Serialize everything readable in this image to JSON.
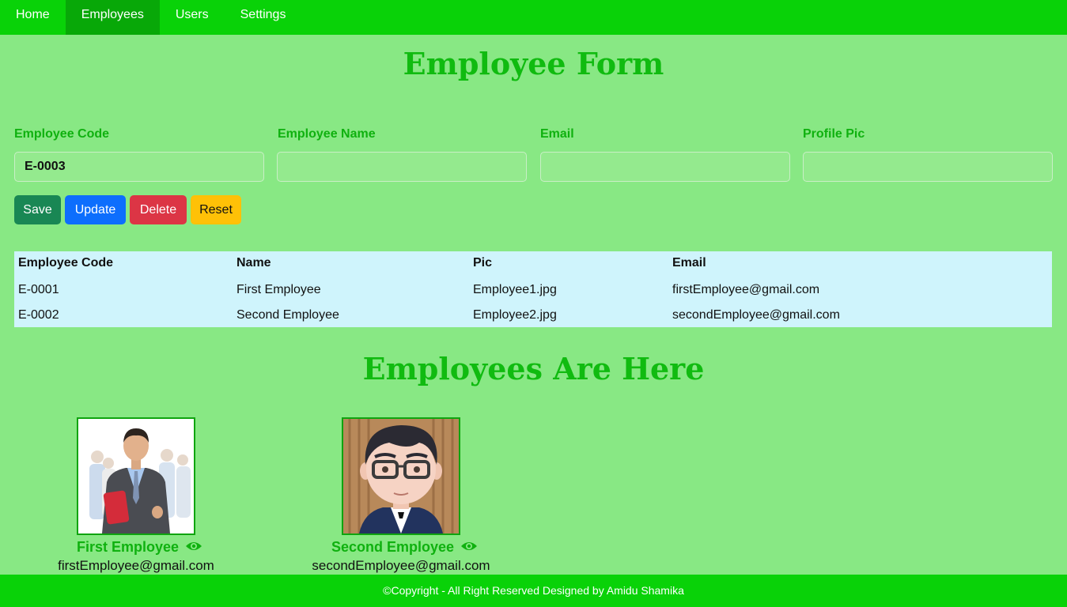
{
  "nav": {
    "items": [
      {
        "label": "Home"
      },
      {
        "label": "Employees"
      },
      {
        "label": "Users"
      },
      {
        "label": "Settings"
      }
    ],
    "active": "Employees"
  },
  "form": {
    "title": "Employee Form",
    "fields": [
      {
        "label": "Employee Code",
        "value": "E-0003"
      },
      {
        "label": "Employee Name",
        "value": ""
      },
      {
        "label": "Email",
        "value": ""
      },
      {
        "label": "Profile Pic",
        "value": ""
      }
    ],
    "buttons": {
      "save": "Save",
      "update": "Update",
      "delete": "Delete",
      "reset": "Reset"
    }
  },
  "table": {
    "headers": [
      "Employee Code",
      "Name",
      "Pic",
      "Email"
    ],
    "rows": [
      [
        "E-0001",
        "First Employee",
        "Employee1.jpg",
        "firstEmployee@gmail.com"
      ],
      [
        "E-0002",
        "Second Employee",
        "Employee2.jpg",
        "secondEmployee@gmail.com"
      ]
    ]
  },
  "cards": {
    "title": "Employees Are Here",
    "items": [
      {
        "name": "First Employee",
        "email": "firstEmployee@gmail.com",
        "icon": "eye-icon"
      },
      {
        "name": "Second Employee",
        "email": "secondEmployee@gmail.com",
        "icon": "eye-icon"
      }
    ]
  },
  "footer": {
    "text": "©Copyright - All Right Reserved Designed by Amidu Shamika"
  },
  "colors": {
    "nav_bg": "#09d208",
    "page_bg": "#88e884",
    "accent_text": "#10bb10",
    "table_bg": "#cff4fc"
  }
}
